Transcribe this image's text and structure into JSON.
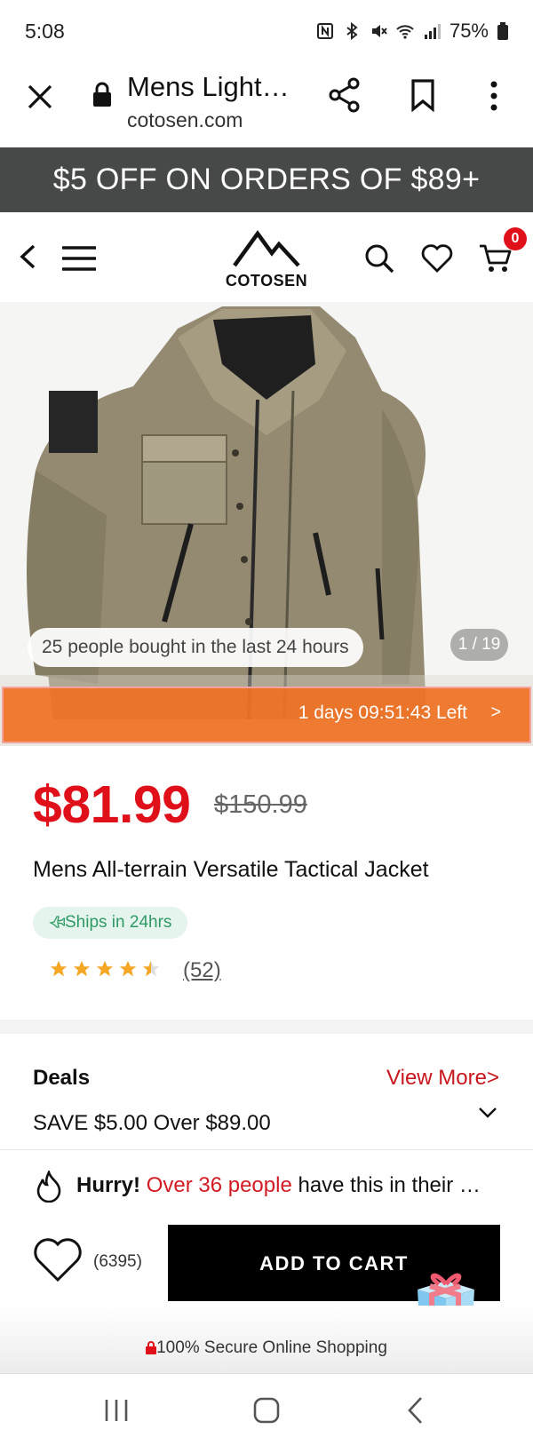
{
  "status_bar": {
    "time": "5:08",
    "battery": "75%"
  },
  "browser": {
    "title": "Mens Light…",
    "url": "cotosen.com"
  },
  "promo_banner": "$5 OFF ON ORDERS OF $89+",
  "header": {
    "logo_text": "COTOSEN",
    "cart_count": "0"
  },
  "gallery": {
    "bought_text": "25 people bought in the last 24 hours",
    "counter": "1 / 19"
  },
  "timer": {
    "text": "1 days 09:51:43 Left",
    "arrow": ">"
  },
  "product": {
    "price": "$81.99",
    "old_price": "$150.99",
    "name": "Mens All-terrain Versatile Tactical Jacket",
    "ships": "Ships in 24hrs",
    "rating": 4.5,
    "review_count": "(52)"
  },
  "deals": {
    "title": "Deals",
    "view_more": "View More>",
    "save_text": "SAVE $5.00 Over $89.00"
  },
  "hurry": {
    "prefix": "Hurry! ",
    "highlight": "Over 36 people",
    "suffix": " have this in their …"
  },
  "actions": {
    "fav_count": "(6395)",
    "add_to_cart": "ADD TO CART"
  },
  "secure_text": "100% Secure Online Shopping",
  "colors": {
    "accent_red": "#e0101a",
    "banner_bg": "#474848",
    "timer_orange": "#f06e1e",
    "ships_green": "#2e9a64"
  }
}
